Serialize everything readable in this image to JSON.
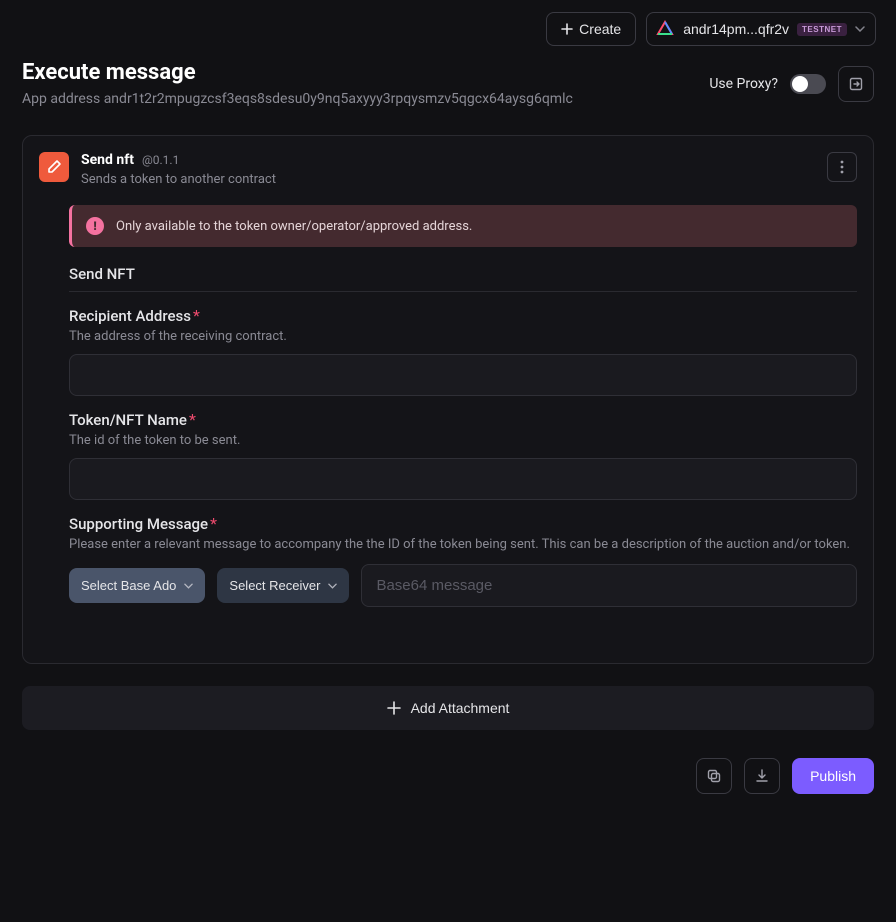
{
  "topbar": {
    "create_label": "Create",
    "wallet_address": "andr14pm...qfr2v",
    "network_badge": "TESTNET"
  },
  "header": {
    "title": "Execute message",
    "subtitle": "App address andr1t2r2mpugzcsf3eqs8sdesu0y9nq5axyyy3rpqysmzv5qgcx64aysg6qmlc",
    "proxy_label": "Use Proxy?"
  },
  "card": {
    "title": "Send nft",
    "version": "@0.1.1",
    "description": "Sends a token to another contract",
    "warning": "Only available to the token owner/operator/approved address.",
    "section_title": "Send NFT",
    "fields": {
      "recipient": {
        "label": "Recipient Address",
        "hint": "The address of the receiving contract."
      },
      "token": {
        "label": "Token/NFT Name",
        "hint": "The id of the token to be sent."
      },
      "support": {
        "label": "Supporting Message",
        "hint": "Please enter a relevant message to accompany the the ID of the token being sent. This can be a description of the auction and/or token.",
        "select_base_label": "Select Base Ado",
        "select_receiver_label": "Select Receiver",
        "msg_placeholder": "Base64 message"
      }
    }
  },
  "actions": {
    "add_attachment": "Add Attachment",
    "publish": "Publish"
  }
}
